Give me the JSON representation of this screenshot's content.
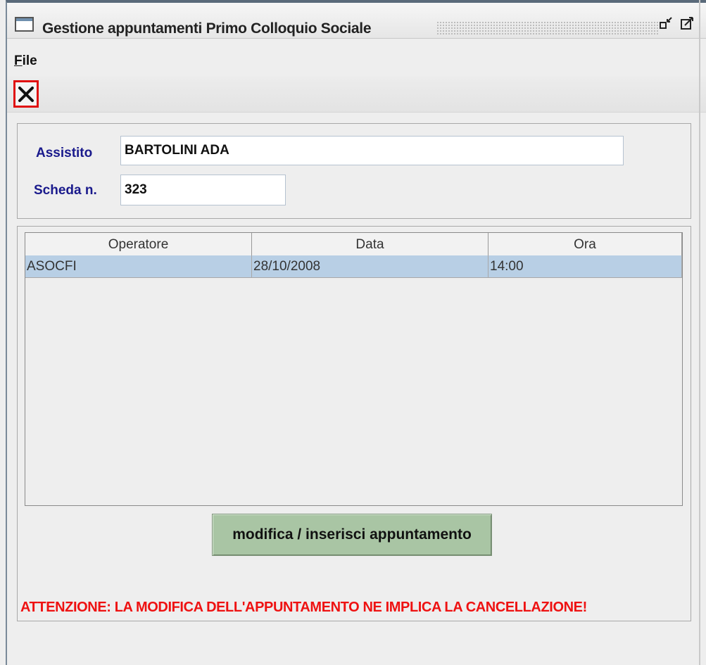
{
  "window": {
    "title": "Gestione appuntamenti Primo Colloquio Sociale",
    "iconify_symbol": "⧉",
    "maximize_symbol": "⬚"
  },
  "menu": {
    "file_label": "File"
  },
  "toolbar": {
    "close_icon": "close-x-icon",
    "close_highlight_color": "#e01010"
  },
  "form": {
    "assistito_label": "Assistito",
    "assistito_value": "BARTOLINI ADA",
    "scheda_label": "Scheda n.",
    "scheda_value": "323",
    "label_color": "#1a1a8c"
  },
  "table": {
    "columns": [
      "Operatore",
      "Data",
      "Ora"
    ],
    "rows": [
      {
        "operatore": "ASOCFI",
        "data": "28/10/2008",
        "ora": "14:00"
      }
    ],
    "selected_row_color": "#b8cfe5"
  },
  "actions": {
    "edit_button_label": "modifica / inserisci appuntamento",
    "edit_button_color": "#a9c5a4"
  },
  "warning": {
    "text": "ATTENZIONE: LA MODIFICA DELL'APPUNTAMENTO NE IMPLICA LA CANCELLAZIONE!",
    "color": "#ee1111"
  }
}
